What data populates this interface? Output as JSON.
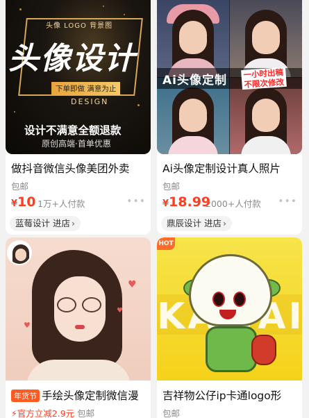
{
  "cards": [
    {
      "thumb": {
        "logo_line": "头像 LOGO 背景图",
        "big_text": "头像设计",
        "badge": "下单即做 满意为止",
        "design_word": "DESIGN",
        "bottom_line1": "设计不满意全额退款",
        "bottom_line2": "原创高端·首单优惠"
      },
      "title": "做抖音微信头像美团外卖",
      "shipping": "包邮",
      "price_currency": "¥",
      "price": "10",
      "sold": "1万+人付款",
      "shop": "蓝莓设计 进店"
    },
    {
      "thumb": {
        "banner_title": "Ai头像定制",
        "red_note_1": "一小时出稿",
        "red_note_2": "不限次修改"
      },
      "title": "Ai头像定制设计真人照片",
      "shipping": "包邮",
      "price_currency": "¥",
      "price": "18.99",
      "sold": "2000+人付款",
      "shop": "鼎辰设计 进店"
    },
    {
      "tag": "年货节",
      "title": "手绘头像定制微信漫",
      "sub_red": "⚡官方立减2.9元",
      "sub_gray": "包邮"
    },
    {
      "thumb": {
        "hot": "HOT",
        "bg_text": "KAWAIG"
      },
      "title": "吉祥物公仔ip卡通logo形",
      "shipping": "包邮"
    }
  ],
  "icons": {
    "more": "more-dots-icon",
    "chevron": "chevron-right-icon"
  },
  "colors": {
    "price_red": "#ff3d1f",
    "muted_gray": "#8a8a8a",
    "page_bg": "#f2f2f2"
  }
}
